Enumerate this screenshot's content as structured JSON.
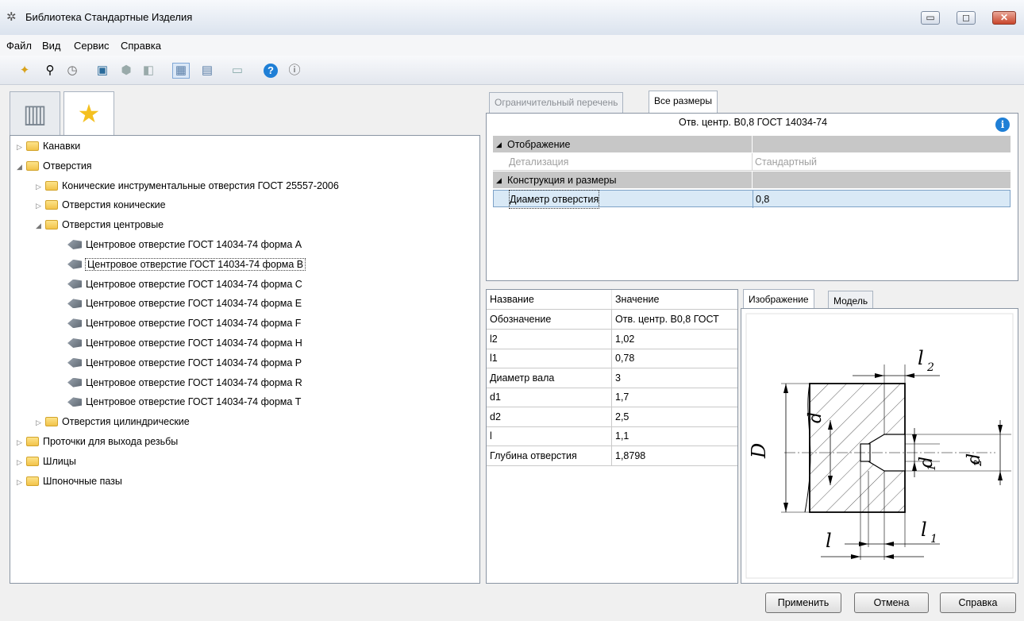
{
  "window": {
    "title": "Библиотека Стандартные Изделия",
    "controls": [
      "▭",
      "◻",
      "✕"
    ]
  },
  "menu": [
    "Файл",
    "Вид",
    "Сервис",
    "Справка"
  ],
  "tree": [
    {
      "label": "Канавки",
      "kind": "folder",
      "level": 0,
      "expanded": false
    },
    {
      "label": "Отверстия",
      "kind": "folder",
      "level": 0,
      "expanded": true
    },
    {
      "label": "Конические инструментальные отверстия ГОСТ 25557-2006",
      "kind": "folder",
      "level": 1,
      "expanded": false
    },
    {
      "label": "Отверстия конические",
      "kind": "folder",
      "level": 1,
      "expanded": false
    },
    {
      "label": "Отверстия центровые",
      "kind": "folder",
      "level": 1,
      "expanded": true
    },
    {
      "label": "Центровое отверстие ГОСТ 14034-74 форма A",
      "kind": "item",
      "level": 2
    },
    {
      "label": "Центровое отверстие ГОСТ 14034-74 форма B",
      "kind": "item",
      "level": 2,
      "selected": true
    },
    {
      "label": "Центровое отверстие ГОСТ 14034-74 форма C",
      "kind": "item",
      "level": 2
    },
    {
      "label": "Центровое отверстие ГОСТ 14034-74 форма E",
      "kind": "item",
      "level": 2
    },
    {
      "label": "Центровое отверстие ГОСТ 14034-74 форма F",
      "kind": "item",
      "level": 2
    },
    {
      "label": "Центровое отверстие ГОСТ 14034-74 форма H",
      "kind": "item",
      "level": 2
    },
    {
      "label": "Центровое отверстие ГОСТ 14034-74 форма P",
      "kind": "item",
      "level": 2
    },
    {
      "label": "Центровое отверстие ГОСТ 14034-74 форма R",
      "kind": "item",
      "level": 2
    },
    {
      "label": "Центровое отверстие ГОСТ 14034-74 форма T",
      "kind": "item",
      "level": 2
    },
    {
      "label": "Отверстия цилиндрические",
      "kind": "folder",
      "level": 1,
      "expanded": false
    },
    {
      "label": "Проточки для выхода резьбы",
      "kind": "folder",
      "level": 0,
      "expanded": false
    },
    {
      "label": "Шлицы",
      "kind": "folder",
      "level": 0,
      "expanded": false
    },
    {
      "label": "Шпоночные пазы",
      "kind": "folder",
      "level": 0,
      "expanded": false
    }
  ],
  "right_tabs": {
    "restrictive": "Ограничительный перечень",
    "all_sizes": "Все размеры"
  },
  "props": {
    "title": "Отв. центр. B0,8 ГОСТ 14034-74",
    "info": "i",
    "cat_display": "Отображение",
    "detail_label": "Детализация",
    "detail_value": "Стандартный",
    "cat_construction": "Конструкция и размеры",
    "diameter_label": "Диаметр отверстия",
    "diameter_value": "0,8"
  },
  "params": {
    "headers": [
      "Название",
      "Значение"
    ],
    "rows": [
      [
        "Обозначение",
        "Отв. центр. B0,8 ГОСТ"
      ],
      [
        "l2",
        "1,02"
      ],
      [
        "l1",
        "0,78"
      ],
      [
        "Диаметр вала",
        "3"
      ],
      [
        "d1",
        "1,7"
      ],
      [
        "d2",
        "2,5"
      ],
      [
        "l",
        "1,1"
      ],
      [
        "Глубина отверстия",
        "1,8798"
      ]
    ]
  },
  "image_tabs": {
    "image": "Изображение",
    "model": "Модель"
  },
  "drawing_labels": {
    "l2": "l",
    "l2_sub": "2",
    "d": "d",
    "D": "D",
    "d1": "d",
    "d1_sub": "1",
    "d2": "d",
    "d2_sub": "2",
    "l": "l",
    "l1": "l",
    "l1_sub": "1"
  },
  "buttons": {
    "apply": "Применить",
    "cancel": "Отмена",
    "help": "Справка"
  }
}
